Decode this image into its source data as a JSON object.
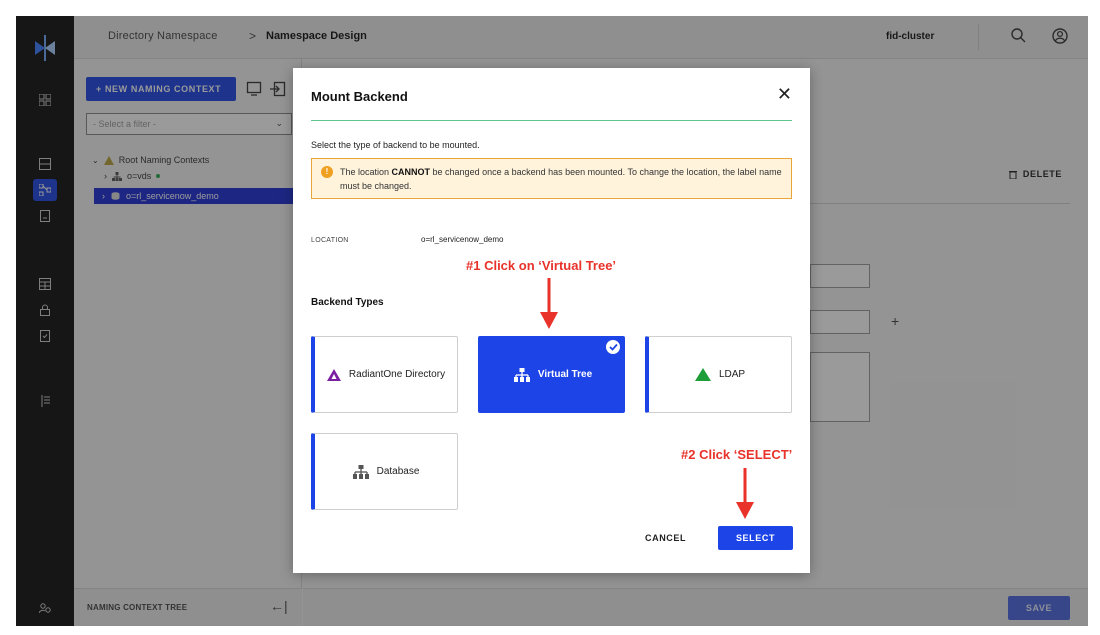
{
  "header": {
    "breadcrumb_root": "Directory Namespace",
    "breadcrumb_sep": ">",
    "breadcrumb_current": "Namespace Design",
    "cluster": "fid-cluster"
  },
  "left_panel": {
    "new_button": "+ NEW NAMING CONTEXT",
    "filter_placeholder": "- Select a filter -",
    "tree": {
      "root_label": "Root Naming Contexts",
      "node_vds": "o=vds",
      "node_servicenow": "o=rl_servicenow_demo"
    },
    "footer_title": "NAMING CONTEXT TREE"
  },
  "main": {
    "delete_label": "DELETE",
    "save_label": "SAVE",
    "plus_label": "+"
  },
  "modal": {
    "title": "Mount Backend",
    "description": "Select the type of backend to be mounted.",
    "warning_prefix": "The location ",
    "warning_bold": "CANNOT",
    "warning_suffix": " be changed once a backend has been mounted. To change the location, the label name must be changed.",
    "location_label": "LOCATION",
    "location_value": "o=rl_servicenow_demo",
    "backend_types_label": "Backend Types",
    "cards": [
      {
        "label": "RadiantOne Directory",
        "icon": "radiantone-triangle-icon",
        "selected": false
      },
      {
        "label": "Virtual Tree",
        "icon": "hierarchy-icon",
        "selected": true
      },
      {
        "label": "LDAP",
        "icon": "ldap-triangle-icon",
        "selected": false
      },
      {
        "label": "Database",
        "icon": "hierarchy-icon",
        "selected": false
      }
    ],
    "cancel_label": "CANCEL",
    "select_label": "SELECT"
  },
  "annotations": {
    "step1": "#1 Click on ‘Virtual Tree’",
    "step2": "#2 Click ‘SELECT’"
  },
  "colors": {
    "accent": "#1d44e6",
    "annotation": "#e8322a",
    "warning_border": "#e8a53a",
    "warning_bg": "#fff3dc",
    "radiantone_purple": "#7a1fa2",
    "ldap_green": "#1e9e3a"
  }
}
